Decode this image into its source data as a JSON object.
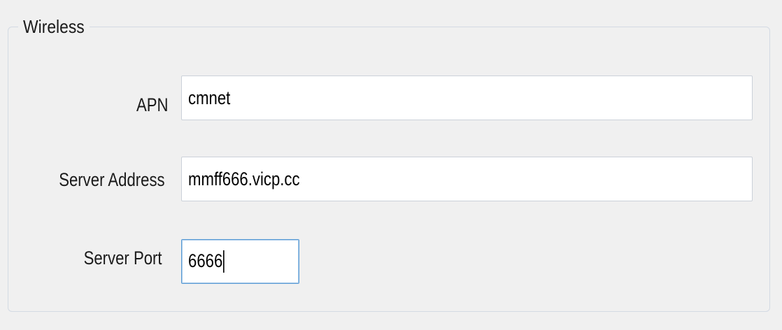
{
  "group": {
    "title": "Wireless"
  },
  "fields": {
    "apn": {
      "label": "APN",
      "value": "cmnet"
    },
    "server_address": {
      "label": "Server Address",
      "value": "mmff666.vicp.cc"
    },
    "server_port": {
      "label": "Server Port",
      "value": "6666"
    }
  },
  "colors": {
    "background": "#f0f0f0",
    "group_border": "#d3dae3",
    "input_border": "#cbd1d9",
    "focus_border": "#5a9bd5"
  }
}
